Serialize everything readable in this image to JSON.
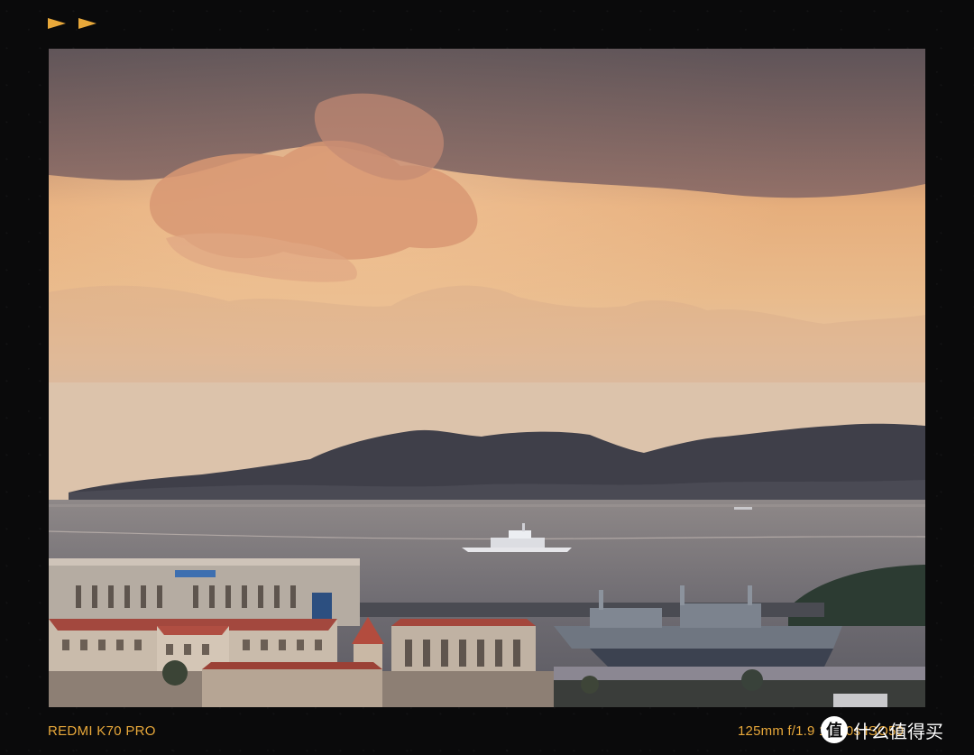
{
  "camera_model": "REDMI K70 PRO",
  "exif": "125mm  f/1.9  1/100s  ISO50",
  "watermark": {
    "logo_glyph": "值",
    "text": "什么值得买",
    "logo_icon": "smzdm-logo"
  },
  "colors": {
    "accent": "#e8a83a",
    "background": "#0a0a0b"
  },
  "photo": {
    "subject": "sunset-harbor-scene"
  }
}
